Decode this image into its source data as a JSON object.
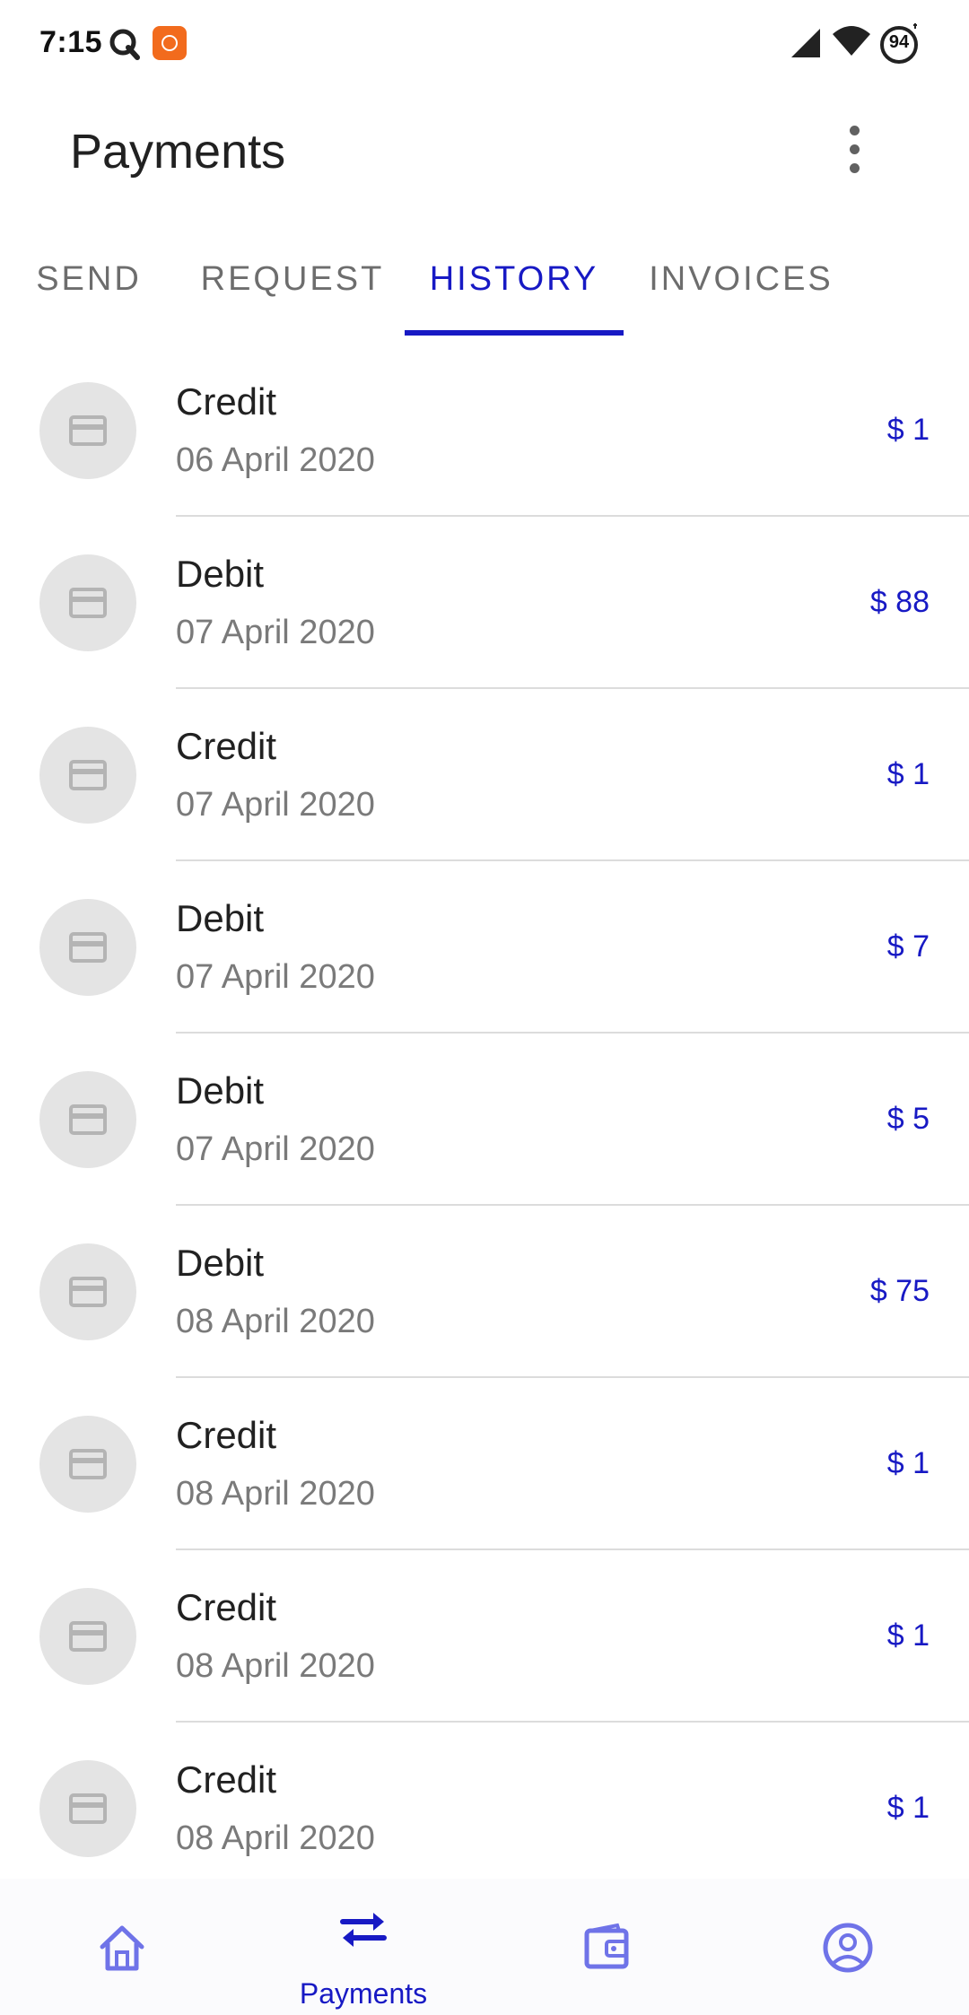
{
  "status_bar": {
    "time": "7:15",
    "battery": "94",
    "icons": [
      "q-icon",
      "mi-app-icon",
      "signal-icon",
      "wifi-icon",
      "battery-icon"
    ]
  },
  "app_bar": {
    "title": "Payments",
    "menu_icon": "more-vert-icon"
  },
  "tabs": [
    {
      "label": "SEND",
      "active": false
    },
    {
      "label": "REQUEST",
      "active": false
    },
    {
      "label": "HISTORY",
      "active": true
    },
    {
      "label": "INVOICES",
      "active": false
    }
  ],
  "history": [
    {
      "type": "Credit",
      "date": "06 April 2020",
      "amount": "$ 1"
    },
    {
      "type": "Debit",
      "date": "07 April 2020",
      "amount": "$ 88"
    },
    {
      "type": "Credit",
      "date": "07 April 2020",
      "amount": "$ 1"
    },
    {
      "type": "Debit",
      "date": "07 April 2020",
      "amount": "$ 7"
    },
    {
      "type": "Debit",
      "date": "07 April 2020",
      "amount": "$ 5"
    },
    {
      "type": "Debit",
      "date": "08 April 2020",
      "amount": "$ 75"
    },
    {
      "type": "Credit",
      "date": "08 April 2020",
      "amount": "$ 1"
    },
    {
      "type": "Credit",
      "date": "08 April 2020",
      "amount": "$ 1"
    },
    {
      "type": "Credit",
      "date": "08 April 2020",
      "amount": "$ 1"
    }
  ],
  "bottom_nav": {
    "items": [
      {
        "icon": "home-icon",
        "label": "",
        "active": false
      },
      {
        "icon": "swap-arrows-icon",
        "label": "Payments",
        "active": true
      },
      {
        "icon": "wallet-icon",
        "label": "",
        "active": false
      },
      {
        "icon": "account-circle-icon",
        "label": "",
        "active": false
      }
    ]
  },
  "colors": {
    "accent": "#1719c4",
    "inactive_tab": "#6d6d6d",
    "avatar_bg": "#e4e4e4",
    "nav_icon": "#6f73e8"
  }
}
